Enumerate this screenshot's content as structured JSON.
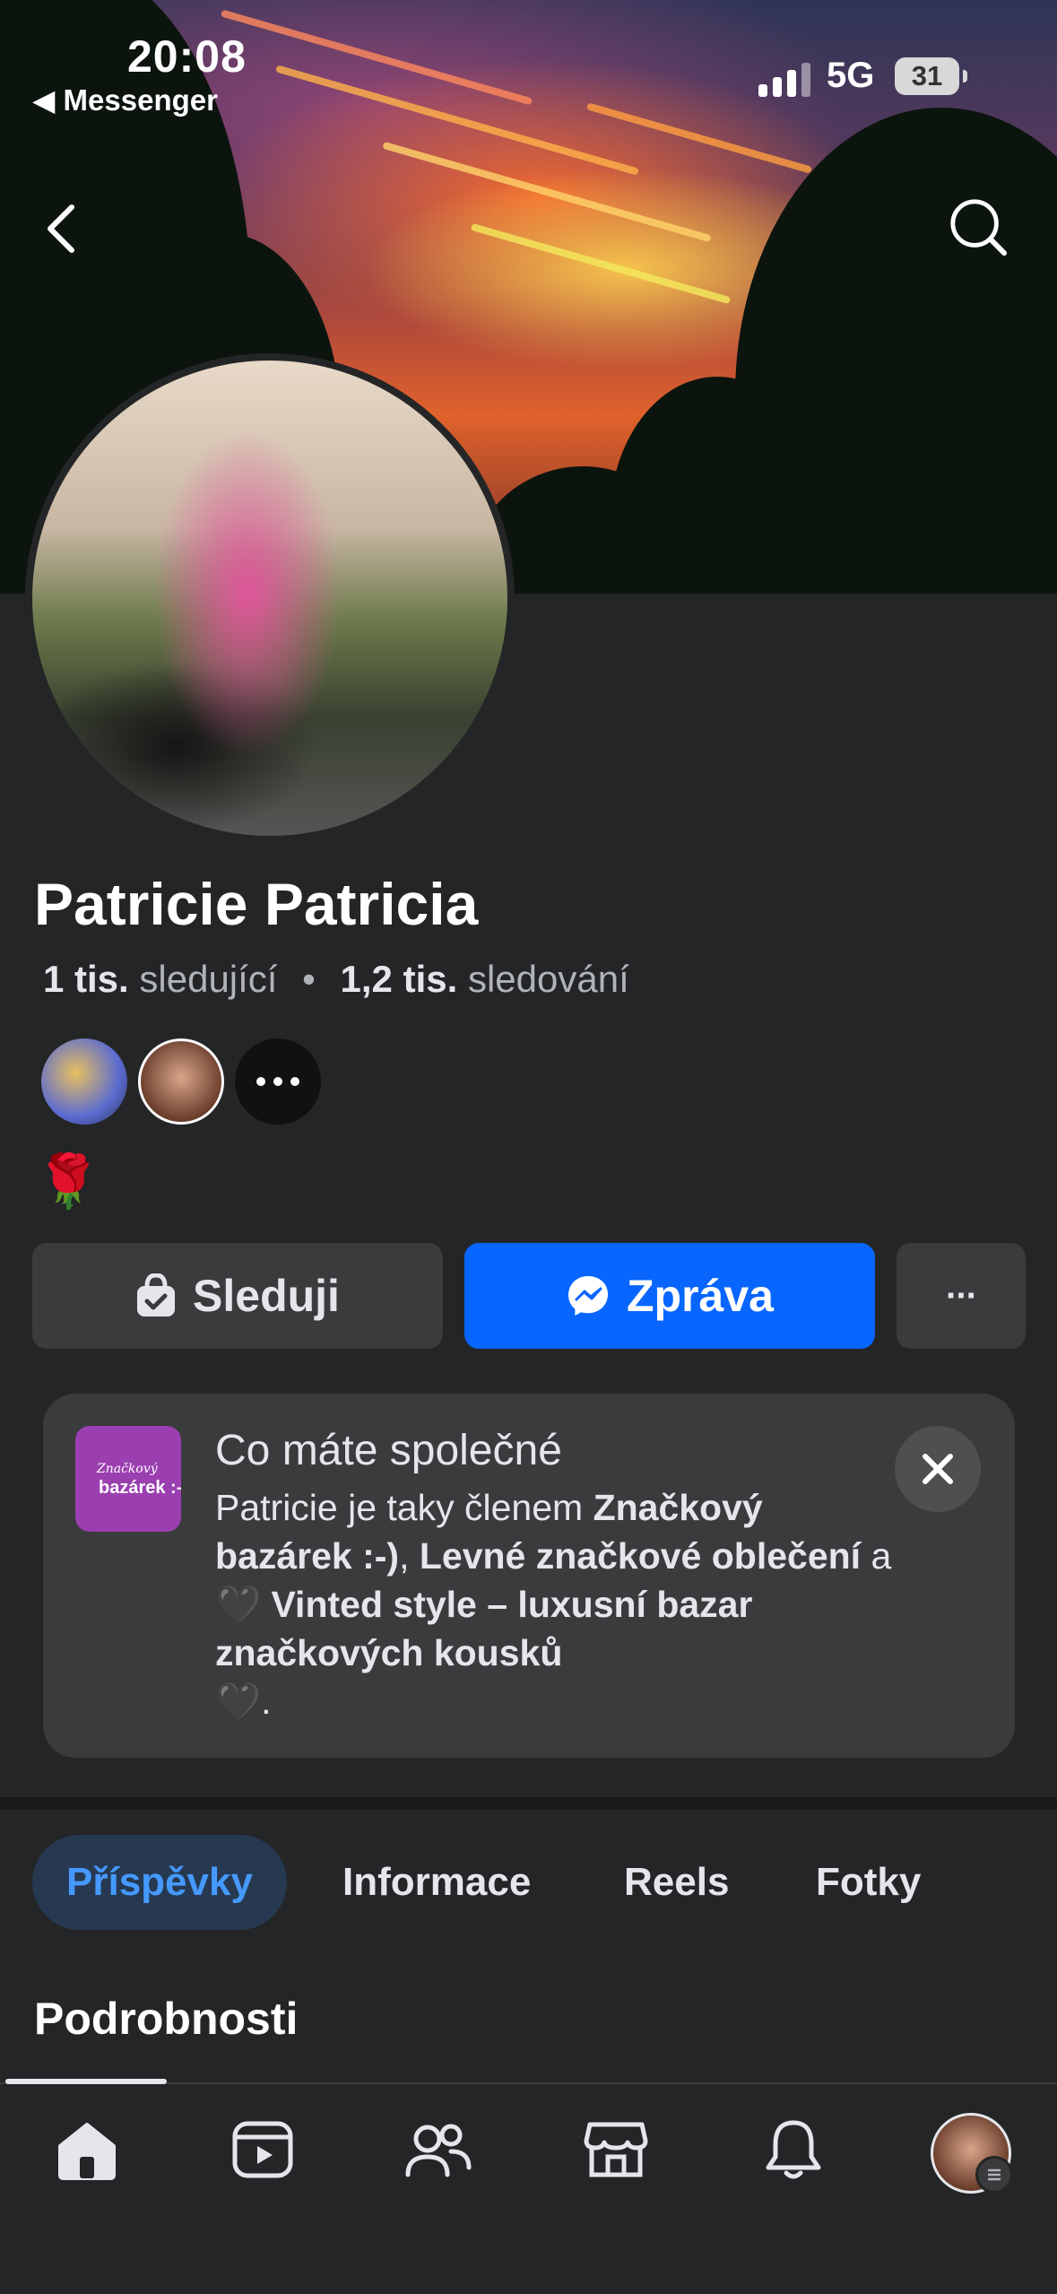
{
  "status_bar": {
    "time": "20:08",
    "back_app": "◀ Messenger",
    "network": "5G",
    "battery": "31"
  },
  "profile": {
    "name": "Patricie Patricia",
    "followers_count": "1 tis.",
    "followers_label": "sledující",
    "separator": "•",
    "following_count": "1,2 tis.",
    "following_label": "sledování",
    "bio_emoji": "🌹"
  },
  "actions": {
    "follow_label": "Sleduji",
    "message_label": "Zpráva",
    "more_label": "···"
  },
  "common_card": {
    "title": "Co máte společné",
    "logo_line1": "Značkový",
    "logo_line2": "bazárek :-)",
    "text_prefix": "Patricie je taky členem ",
    "group1": "Značkový bazárek :-)",
    "sep1": ", ",
    "group2": "Levné značkové oblečení",
    "sep2": " a ",
    "heart1": "🖤",
    "group3": " Vinted style – luxusní bazar značkových kousků",
    "heart2": "🖤",
    "suffix": "."
  },
  "tabs": [
    {
      "label": "Příspěvky",
      "active": true
    },
    {
      "label": "Informace",
      "active": false
    },
    {
      "label": "Reels",
      "active": false
    },
    {
      "label": "Fotky",
      "active": false
    }
  ],
  "section_title": "Podrobnosti",
  "colors": {
    "background": "#242526",
    "card": "#3a3b3c",
    "primary": "#0866ff",
    "accent_text": "#4599ff"
  },
  "bottom_nav": [
    "home-icon",
    "video-icon",
    "friends-icon",
    "marketplace-icon",
    "bell-icon",
    "profile-avatar"
  ]
}
